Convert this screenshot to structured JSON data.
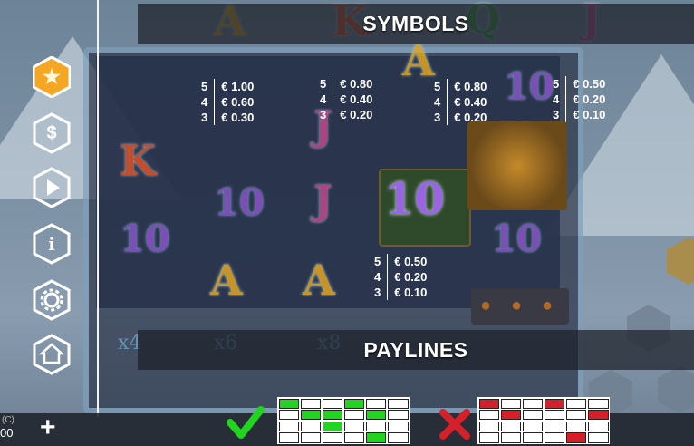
{
  "header": {
    "title": "SYMBOLS"
  },
  "paylines": {
    "title": "PAYLINES"
  },
  "menu": [
    {
      "icon": "star-icon"
    },
    {
      "icon": "dollar-icon"
    },
    {
      "icon": "play-icon"
    },
    {
      "icon": "info-icon"
    },
    {
      "icon": "gear-icon"
    },
    {
      "icon": "home-icon"
    }
  ],
  "paytable": [
    {
      "symbol": "K",
      "rows": [
        [
          "5",
          "€ 1.00"
        ],
        [
          "4",
          "€ 0.60"
        ],
        [
          "3",
          "€ 0.30"
        ]
      ]
    },
    {
      "symbol": "J",
      "rows": [
        [
          "5",
          "€ 0.80"
        ],
        [
          "4",
          "€ 0.40"
        ],
        [
          "3",
          "€ 0.20"
        ]
      ]
    },
    {
      "symbol": "Q",
      "rows": [
        [
          "5",
          "€ 0.80"
        ],
        [
          "4",
          "€ 0.40"
        ],
        [
          "3",
          "€ 0.20"
        ]
      ]
    },
    {
      "symbol": "A",
      "rows": [
        [
          "5",
          "€ 0.50"
        ],
        [
          "4",
          "€ 0.20"
        ],
        [
          "3",
          "€ 0.10"
        ]
      ]
    },
    {
      "symbol": "10",
      "rows": [
        [
          "5",
          "€ 0.50"
        ],
        [
          "4",
          "€ 0.20"
        ],
        [
          "3",
          "€ 0.10"
        ]
      ]
    }
  ],
  "background_multipliers": [
    "x4",
    "x6",
    "x8"
  ],
  "bottom": {
    "credit_label": "(C)",
    "credit_value": "00",
    "plus_label": "+"
  },
  "payline_examples": {
    "valid_icon": "checkmark-icon",
    "invalid_icon": "cross-icon",
    "valid_grid": [
      [
        1,
        0,
        0,
        1,
        0,
        0
      ],
      [
        0,
        1,
        1,
        0,
        1,
        0
      ],
      [
        0,
        0,
        1,
        0,
        0,
        0
      ],
      [
        0,
        0,
        0,
        0,
        1,
        0
      ]
    ],
    "invalid_grid": [
      [
        1,
        0,
        0,
        1,
        0,
        0
      ],
      [
        0,
        1,
        0,
        0,
        0,
        1
      ],
      [
        0,
        0,
        0,
        0,
        0,
        0
      ],
      [
        0,
        0,
        0,
        0,
        1,
        0
      ]
    ]
  },
  "colors": {
    "valid": "#22d420",
    "invalid": "#d42028",
    "star": "#f5a623"
  }
}
